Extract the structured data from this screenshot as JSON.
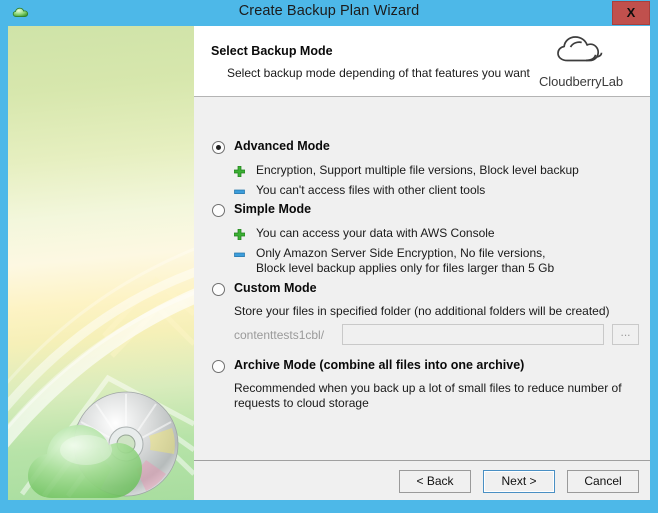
{
  "window": {
    "title": "Create Backup Plan Wizard",
    "close_label": "X",
    "title_icon": "cloud-icon",
    "accent_color": "#4db8e8",
    "close_color": "#c0504d"
  },
  "header": {
    "title": "Select Backup Mode",
    "subtitle": "Select backup mode depending of that features you want",
    "logo_text": "CloudberryLab",
    "logo_icon": "cloud-logo-icon"
  },
  "options": [
    {
      "id": "advanced",
      "label": "Advanced Mode",
      "selected": true,
      "features": [
        {
          "icon": "plus-icon",
          "kind": "pro",
          "text": "Encryption, Support multiple file versions, Block level backup"
        },
        {
          "icon": "minus-icon",
          "kind": "con",
          "text": "You can't access files with other client tools"
        }
      ]
    },
    {
      "id": "simple",
      "label": "Simple Mode",
      "selected": false,
      "features": [
        {
          "icon": "plus-icon",
          "kind": "pro",
          "text": "You can access your data with AWS Console"
        },
        {
          "icon": "minus-icon",
          "kind": "con",
          "text": "Only Amazon Server Side Encryption, No file versions, Block level backup applies only for files larger than 5 Gb"
        }
      ]
    },
    {
      "id": "custom",
      "label": "Custom Mode",
      "selected": false,
      "description": "Store your files in specified folder (no additional folders will be created)",
      "path": {
        "prefix": "contenttests1cbl/",
        "value": "",
        "placeholder": "",
        "browse_label": "...",
        "enabled": false
      }
    },
    {
      "id": "archive",
      "label": "Archive Mode (combine all files into one archive)",
      "selected": false,
      "description": "Recommended when you back up a lot of small files to reduce number of requests to cloud storage"
    }
  ],
  "footer": {
    "back_label": "< Back",
    "next_label": "Next >",
    "cancel_label": "Cancel"
  },
  "colors": {
    "plus_icon": "#3cb034",
    "minus_icon": "#3d9ddb",
    "body_bg": "#f0f0f0",
    "header_bg": "#ffffff"
  }
}
